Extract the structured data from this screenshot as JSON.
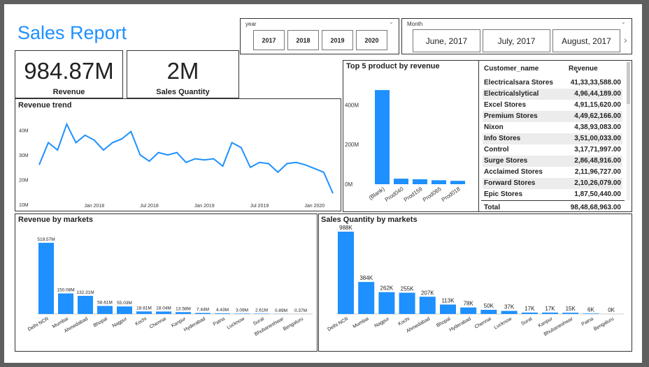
{
  "title": "Sales Report",
  "year_slicer": {
    "label": "year",
    "options": [
      "2017",
      "2018",
      "2019",
      "2020"
    ]
  },
  "month_slicer": {
    "label": "Month",
    "options": [
      "June, 2017",
      "July, 2017",
      "August, 2017"
    ]
  },
  "kpis": [
    {
      "value": "984.87M",
      "label": "Revenue"
    },
    {
      "value": "2M",
      "label": "Sales Quantity"
    }
  ],
  "table": {
    "headers": [
      "Customer_name",
      "Revenue"
    ],
    "rows": [
      [
        "Electricalsara Stores",
        "41,33,33,588.00"
      ],
      [
        "Electricalslytical",
        "4,96,44,189.00"
      ],
      [
        "Excel Stores",
        "4,91,15,620.00"
      ],
      [
        "Premium Stores",
        "4,49,62,166.00"
      ],
      [
        "Nixon",
        "4,38,93,083.00"
      ],
      [
        "Info Stores",
        "3,51,00,033.00"
      ],
      [
        "Control",
        "3,17,71,997.00"
      ],
      [
        "Surge Stores",
        "2,86,48,916.00"
      ],
      [
        "Acclaimed Stores",
        "2,11,96,727.00"
      ],
      [
        "Forward Stores",
        "2,10,26,079.00"
      ],
      [
        "Epic Stores",
        "1,87,50,440.00"
      ]
    ],
    "total_label": "Total",
    "total_value": "98,48,68,963.00",
    "row_bg": "#ececec"
  },
  "chart_data": [
    {
      "type": "line",
      "title": "Revenue trend",
      "ylim": [
        10,
        45
      ],
      "y_ticks": [
        "40M",
        "30M",
        "20M",
        "10M"
      ],
      "y_tick_values": [
        40,
        30,
        20,
        10
      ],
      "x_ticks": [
        "Jan 2018",
        "Jul 2018",
        "Jan 2019",
        "Jul 2019",
        "Jan 2020"
      ],
      "x_tick_index": [
        6,
        12,
        18,
        24,
        30
      ],
      "values": [
        26,
        35,
        32,
        42.5,
        35,
        38,
        36,
        32,
        35,
        36.5,
        39.5,
        30,
        27.5,
        31,
        30,
        31,
        27,
        28.5,
        28,
        28.5,
        25.5,
        35,
        33,
        25,
        27,
        26.5,
        23,
        26.5,
        27,
        26,
        24.5,
        23,
        14.5
      ],
      "color": "#1e90ff"
    },
    {
      "type": "bar",
      "title": "Top 5 product by revenue",
      "categories": [
        "(Blank)",
        "Prod040",
        "Prod159",
        "Prod065",
        "Prod018"
      ],
      "values": [
        475,
        28,
        25,
        20,
        17
      ],
      "y_ticks": [
        "400M",
        "200M",
        "0M"
      ],
      "y_tick_values": [
        400,
        200,
        0
      ],
      "ylim": [
        0,
        500
      ],
      "color": "#1e90ff"
    },
    {
      "type": "bar",
      "title": "Revenue by markets",
      "categories": [
        "Delhi NCR",
        "Mumbai",
        "Ahmedabad",
        "Bhopal",
        "Nagpur",
        "Kochi",
        "Chennai",
        "Kanpur",
        "Hyderabad",
        "Patna",
        "Lucknow",
        "Surat",
        "Bhubaneshwar",
        "Bengaluru"
      ],
      "values": [
        519.57,
        150.08,
        132.31,
        58.61,
        55.03,
        18.81,
        18.04,
        13.58,
        7.44,
        4.43,
        3.09,
        2.61,
        0.89,
        0.37
      ],
      "labels": [
        "519.57M",
        "150.08M",
        "132.31M",
        "58.61M",
        "55.03M",
        "18.81M",
        "18.04M",
        "13.58M",
        "7.44M",
        "4.43M",
        "3.09M",
        "2.61M",
        "0.89M",
        "0.37M"
      ],
      "color": "#1e90ff"
    },
    {
      "type": "bar",
      "title": "Sales Quantity by markets",
      "categories": [
        "Delhi NCR",
        "Mumbai",
        "Nagpur",
        "Kochi",
        "Ahmedabad",
        "Bhopal",
        "Hyderabad",
        "Chennai",
        "Lucknow",
        "Surat",
        "Kanpur",
        "Bhubaneshwar",
        "Patna",
        "Bengaluru"
      ],
      "values": [
        988,
        384,
        262,
        255,
        207,
        113,
        78,
        50,
        37,
        17,
        17,
        15,
        6,
        0
      ],
      "labels": [
        "988K",
        "384K",
        "262K",
        "255K",
        "207K",
        "113K",
        "78K",
        "50K",
        "37K",
        "17K",
        "17K",
        "15K",
        "6K",
        "0K"
      ],
      "color": "#1e90ff"
    }
  ]
}
